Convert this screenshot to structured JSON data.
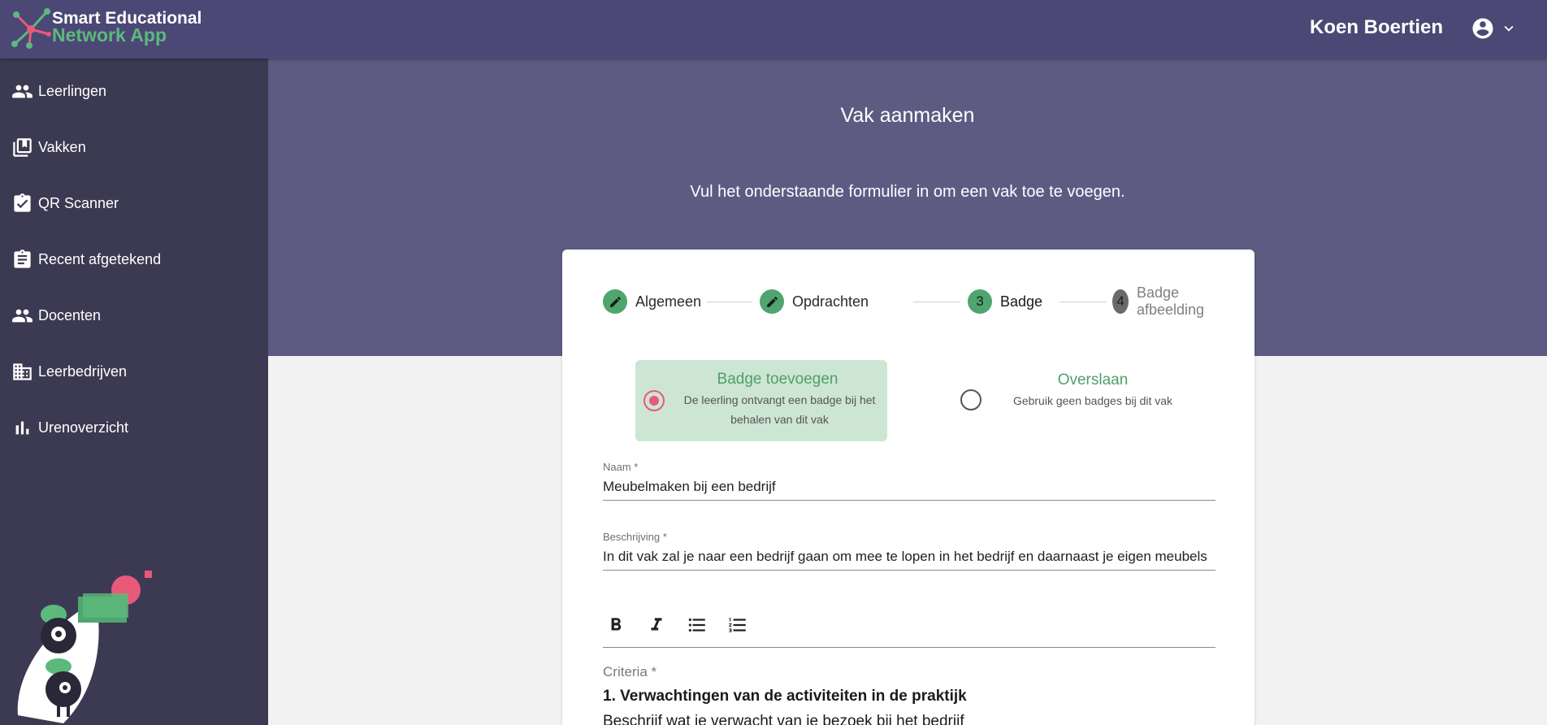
{
  "app": {
    "name_line1": "Smart Educational",
    "name_line2": "Network App",
    "colors": {
      "topbar": "#4b4876",
      "sidebar": "#3c3a52",
      "hero": "#5e5b83",
      "green": "#4fa56e",
      "pink": "#e8597a"
    }
  },
  "header": {
    "user_name": "Koen Boertien",
    "user_icon": "account-circle-icon",
    "menu_icon": "chevron-down-icon"
  },
  "sidebar": {
    "items": [
      {
        "label": "Leerlingen",
        "icon": "people-icon"
      },
      {
        "label": "Vakken",
        "icon": "library-books-icon"
      },
      {
        "label": "QR Scanner",
        "icon": "assignment-check-icon"
      },
      {
        "label": "Recent afgetekend",
        "icon": "assignment-icon"
      },
      {
        "label": "Docenten",
        "icon": "people-icon"
      },
      {
        "label": "Leerbedrijven",
        "icon": "business-icon"
      },
      {
        "label": "Urenoverzicht",
        "icon": "bar-chart-icon"
      }
    ]
  },
  "page": {
    "title": "Vak aanmaken",
    "subtitle": "Vul het onderstaande formulier in om een vak toe te voegen."
  },
  "stepper": {
    "steps": [
      {
        "number": "",
        "label": "Algemeen",
        "state": "done",
        "icon": "pencil-icon"
      },
      {
        "number": "",
        "label": "Opdrachten",
        "state": "done",
        "icon": "pencil-icon"
      },
      {
        "number": "3",
        "label": "Badge",
        "state": "active"
      },
      {
        "number": "4",
        "label": "Badge afbeelding",
        "state": "todo"
      }
    ]
  },
  "badge_options": {
    "add": {
      "title": "Badge toevoegen",
      "description": "De leerling ontvangt een badge bij het behalen van dit vak",
      "selected": true
    },
    "skip": {
      "title": "Overslaan",
      "description": "Gebruik geen badges bij dit vak",
      "selected": false
    }
  },
  "form": {
    "name_label": "Naam *",
    "name_value": "Meubelmaken bij een bedrijf",
    "description_label": "Beschrijving *",
    "description_value": "In dit vak zal je naar een bedrijf gaan om mee te lopen in het bedrijf en daarnaast je eigen meubels",
    "toolbar": [
      "bold-icon",
      "italic-icon",
      "bulleted-list-icon",
      "numbered-list-icon"
    ],
    "criteria_label": "Criteria *",
    "criteria_heading": "1. Verwachtingen van de activiteiten in de praktijk",
    "criteria_text": "Beschrijf wat je verwacht van je bezoek bij het bedrijf"
  }
}
